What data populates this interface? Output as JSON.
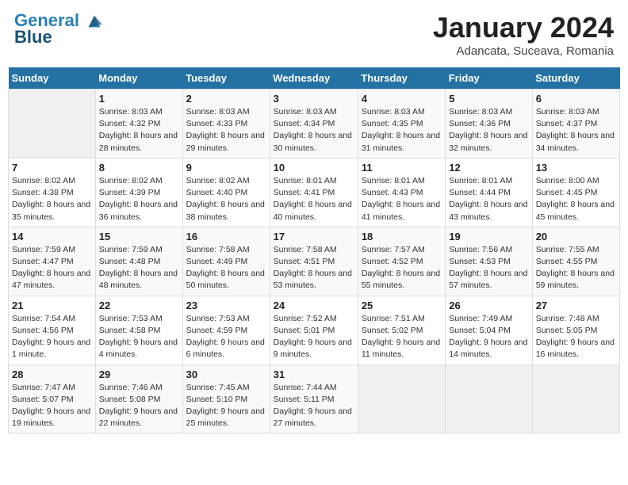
{
  "header": {
    "logo_line1": "General",
    "logo_line2": "Blue",
    "month_title": "January 2024",
    "location": "Adancata, Suceava, Romania"
  },
  "weekdays": [
    "Sunday",
    "Monday",
    "Tuesday",
    "Wednesday",
    "Thursday",
    "Friday",
    "Saturday"
  ],
  "weeks": [
    [
      {
        "day": "",
        "sunrise": "",
        "sunset": "",
        "daylight": "",
        "empty": true
      },
      {
        "day": "1",
        "sunrise": "Sunrise: 8:03 AM",
        "sunset": "Sunset: 4:32 PM",
        "daylight": "Daylight: 8 hours and 28 minutes."
      },
      {
        "day": "2",
        "sunrise": "Sunrise: 8:03 AM",
        "sunset": "Sunset: 4:33 PM",
        "daylight": "Daylight: 8 hours and 29 minutes."
      },
      {
        "day": "3",
        "sunrise": "Sunrise: 8:03 AM",
        "sunset": "Sunset: 4:34 PM",
        "daylight": "Daylight: 8 hours and 30 minutes."
      },
      {
        "day": "4",
        "sunrise": "Sunrise: 8:03 AM",
        "sunset": "Sunset: 4:35 PM",
        "daylight": "Daylight: 8 hours and 31 minutes."
      },
      {
        "day": "5",
        "sunrise": "Sunrise: 8:03 AM",
        "sunset": "Sunset: 4:36 PM",
        "daylight": "Daylight: 8 hours and 32 minutes."
      },
      {
        "day": "6",
        "sunrise": "Sunrise: 8:03 AM",
        "sunset": "Sunset: 4:37 PM",
        "daylight": "Daylight: 8 hours and 34 minutes."
      }
    ],
    [
      {
        "day": "7",
        "sunrise": "Sunrise: 8:02 AM",
        "sunset": "Sunset: 4:38 PM",
        "daylight": "Daylight: 8 hours and 35 minutes."
      },
      {
        "day": "8",
        "sunrise": "Sunrise: 8:02 AM",
        "sunset": "Sunset: 4:39 PM",
        "daylight": "Daylight: 8 hours and 36 minutes."
      },
      {
        "day": "9",
        "sunrise": "Sunrise: 8:02 AM",
        "sunset": "Sunset: 4:40 PM",
        "daylight": "Daylight: 8 hours and 38 minutes."
      },
      {
        "day": "10",
        "sunrise": "Sunrise: 8:01 AM",
        "sunset": "Sunset: 4:41 PM",
        "daylight": "Daylight: 8 hours and 40 minutes."
      },
      {
        "day": "11",
        "sunrise": "Sunrise: 8:01 AM",
        "sunset": "Sunset: 4:43 PM",
        "daylight": "Daylight: 8 hours and 41 minutes."
      },
      {
        "day": "12",
        "sunrise": "Sunrise: 8:01 AM",
        "sunset": "Sunset: 4:44 PM",
        "daylight": "Daylight: 8 hours and 43 minutes."
      },
      {
        "day": "13",
        "sunrise": "Sunrise: 8:00 AM",
        "sunset": "Sunset: 4:45 PM",
        "daylight": "Daylight: 8 hours and 45 minutes."
      }
    ],
    [
      {
        "day": "14",
        "sunrise": "Sunrise: 7:59 AM",
        "sunset": "Sunset: 4:47 PM",
        "daylight": "Daylight: 8 hours and 47 minutes."
      },
      {
        "day": "15",
        "sunrise": "Sunrise: 7:59 AM",
        "sunset": "Sunset: 4:48 PM",
        "daylight": "Daylight: 8 hours and 48 minutes."
      },
      {
        "day": "16",
        "sunrise": "Sunrise: 7:58 AM",
        "sunset": "Sunset: 4:49 PM",
        "daylight": "Daylight: 8 hours and 50 minutes."
      },
      {
        "day": "17",
        "sunrise": "Sunrise: 7:58 AM",
        "sunset": "Sunset: 4:51 PM",
        "daylight": "Daylight: 8 hours and 53 minutes."
      },
      {
        "day": "18",
        "sunrise": "Sunrise: 7:57 AM",
        "sunset": "Sunset: 4:52 PM",
        "daylight": "Daylight: 8 hours and 55 minutes."
      },
      {
        "day": "19",
        "sunrise": "Sunrise: 7:56 AM",
        "sunset": "Sunset: 4:53 PM",
        "daylight": "Daylight: 8 hours and 57 minutes."
      },
      {
        "day": "20",
        "sunrise": "Sunrise: 7:55 AM",
        "sunset": "Sunset: 4:55 PM",
        "daylight": "Daylight: 8 hours and 59 minutes."
      }
    ],
    [
      {
        "day": "21",
        "sunrise": "Sunrise: 7:54 AM",
        "sunset": "Sunset: 4:56 PM",
        "daylight": "Daylight: 9 hours and 1 minute."
      },
      {
        "day": "22",
        "sunrise": "Sunrise: 7:53 AM",
        "sunset": "Sunset: 4:58 PM",
        "daylight": "Daylight: 9 hours and 4 minutes."
      },
      {
        "day": "23",
        "sunrise": "Sunrise: 7:53 AM",
        "sunset": "Sunset: 4:59 PM",
        "daylight": "Daylight: 9 hours and 6 minutes."
      },
      {
        "day": "24",
        "sunrise": "Sunrise: 7:52 AM",
        "sunset": "Sunset: 5:01 PM",
        "daylight": "Daylight: 9 hours and 9 minutes."
      },
      {
        "day": "25",
        "sunrise": "Sunrise: 7:51 AM",
        "sunset": "Sunset: 5:02 PM",
        "daylight": "Daylight: 9 hours and 11 minutes."
      },
      {
        "day": "26",
        "sunrise": "Sunrise: 7:49 AM",
        "sunset": "Sunset: 5:04 PM",
        "daylight": "Daylight: 9 hours and 14 minutes."
      },
      {
        "day": "27",
        "sunrise": "Sunrise: 7:48 AM",
        "sunset": "Sunset: 5:05 PM",
        "daylight": "Daylight: 9 hours and 16 minutes."
      }
    ],
    [
      {
        "day": "28",
        "sunrise": "Sunrise: 7:47 AM",
        "sunset": "Sunset: 5:07 PM",
        "daylight": "Daylight: 9 hours and 19 minutes."
      },
      {
        "day": "29",
        "sunrise": "Sunrise: 7:46 AM",
        "sunset": "Sunset: 5:08 PM",
        "daylight": "Daylight: 9 hours and 22 minutes."
      },
      {
        "day": "30",
        "sunrise": "Sunrise: 7:45 AM",
        "sunset": "Sunset: 5:10 PM",
        "daylight": "Daylight: 9 hours and 25 minutes."
      },
      {
        "day": "31",
        "sunrise": "Sunrise: 7:44 AM",
        "sunset": "Sunset: 5:11 PM",
        "daylight": "Daylight: 9 hours and 27 minutes."
      },
      {
        "day": "",
        "sunrise": "",
        "sunset": "",
        "daylight": "",
        "empty": true
      },
      {
        "day": "",
        "sunrise": "",
        "sunset": "",
        "daylight": "",
        "empty": true
      },
      {
        "day": "",
        "sunrise": "",
        "sunset": "",
        "daylight": "",
        "empty": true
      }
    ]
  ]
}
